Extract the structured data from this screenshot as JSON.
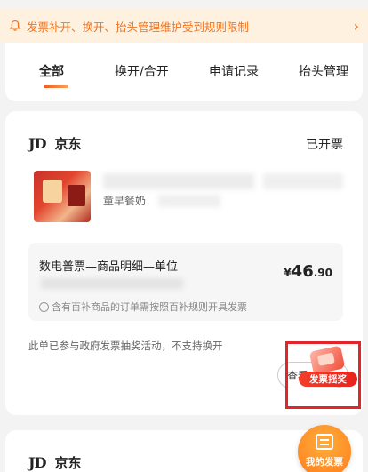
{
  "notice": {
    "text": "发票补开、换开、抬头管理维护受到规则限制",
    "chevron": "›"
  },
  "tabs": [
    {
      "label": "全部",
      "active": true
    },
    {
      "label": "换开/合开",
      "active": false
    },
    {
      "label": "申请记录",
      "active": false
    },
    {
      "label": "抬头管理",
      "active": false
    }
  ],
  "order": {
    "shop_logo": "JD",
    "shop_name": "京东",
    "status": "已开票",
    "product_title_visible": "童早餐奶",
    "invoice": {
      "type": "数电普票—商品明细—单位",
      "amount_currency": "¥",
      "amount_int": "46",
      "amount_dec": ".90",
      "note": "含有百补商品的订单需按照百补规则开具发票"
    },
    "activity_note": "此单已参与政府发票抽奖活动，不支持换开",
    "check_button_partial": "查看"
  },
  "lottery_badge": {
    "label": "发票摇奖"
  },
  "order2": {
    "shop_logo": "JD",
    "shop_name": "京东"
  },
  "floating_button": {
    "label": "我的发票"
  },
  "colors": {
    "accent": "#f05a1e",
    "highlight": "#e0262b",
    "notice_bg": "#fff1e0"
  }
}
